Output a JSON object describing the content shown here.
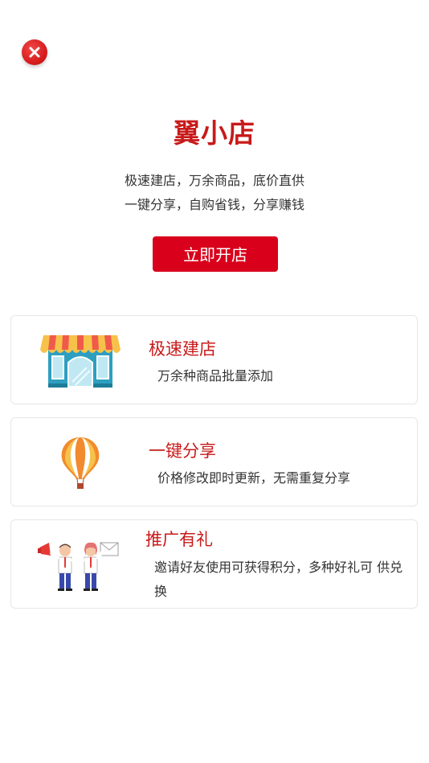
{
  "header": {
    "close_icon": "close-icon"
  },
  "hero": {
    "title": "翼小店",
    "subtitle_line1": "极速建店，万余商品，底价直供",
    "subtitle_line2": "一键分享，自购省钱，分享赚钱",
    "open_button_label": "立即开店"
  },
  "features": [
    {
      "icon": "storefront-icon",
      "title": "极速建店",
      "description": "万余种商品批量添加"
    },
    {
      "icon": "hot-air-balloon-icon",
      "title": "一键分享",
      "description": "价格修改即时更新，无需重复分享"
    },
    {
      "icon": "promoters-icon",
      "title": "推广有礼",
      "description": "邀请好友使用可获得积分，多种好礼可 供兑换"
    }
  ],
  "colors": {
    "brand_red": "#d9001b",
    "title_red": "#c81a1a",
    "text_dark": "#333333"
  }
}
